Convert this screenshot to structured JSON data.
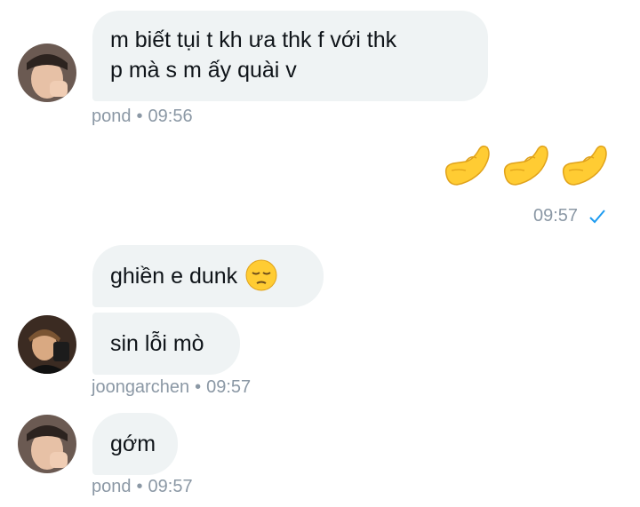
{
  "messages": [
    {
      "text_line1": "m biết tụi t kh ưa thk f với thk",
      "text_line2": "p mà s m ấy quài v",
      "author": "pond",
      "time": "09:56"
    },
    {
      "emojis": [
        "pinched-fingers",
        "pinched-fingers",
        "pinched-fingers"
      ],
      "time": "09:57",
      "status": "read-check"
    },
    {
      "text": "ghiền e dunk",
      "emoji": "pensive-face"
    },
    {
      "text": "sin lỗi mò",
      "author": "joongarchen",
      "time": "09:57"
    },
    {
      "text": "gớm",
      "author": "pond",
      "time": "09:57"
    }
  ],
  "meta": {
    "separator": "•"
  },
  "colors": {
    "bubble_bg": "#eff3f4",
    "text": "#0f1419",
    "meta": "#8b98a5",
    "read_check": "#1d9bf0",
    "emoji": "#ffcc33"
  }
}
